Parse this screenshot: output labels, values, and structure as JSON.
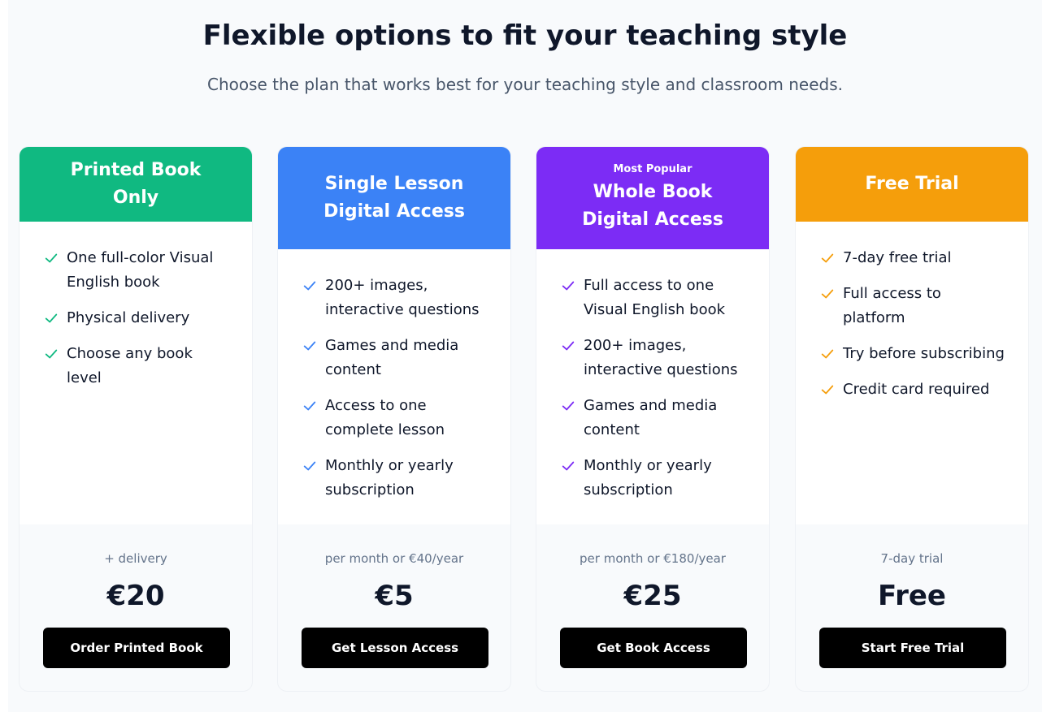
{
  "header": {
    "title": "Flexible options to fit your teaching style",
    "subtitle": "Choose the plan that works best for your teaching style and classroom needs."
  },
  "plans": [
    {
      "name": "Printed Book Only",
      "color": "#10b981",
      "features": [
        "One full-color Visual English book",
        "Physical delivery",
        "Choose any book level"
      ],
      "price_note": "+ delivery",
      "price": "€20",
      "button": "Order Printed Book"
    },
    {
      "name": "Single Lesson Digital Access",
      "color": "#3b82f6",
      "features": [
        "200+ images, interactive questions",
        "Games and media content",
        "Access to one complete lesson",
        "Monthly or yearly subscription"
      ],
      "price_note": "per month or €40/year",
      "price": "€5",
      "button": "Get Lesson Access"
    },
    {
      "name": "Whole Book Digital Access",
      "badge": "Most Popular",
      "color": "#7c2cf5",
      "features": [
        "Full access to one Visual English book",
        "200+ images, interactive questions",
        "Games and media content",
        "Monthly or yearly subscription"
      ],
      "price_note": "per month or €180/year",
      "price": "€25",
      "button": "Get Book Access"
    },
    {
      "name": "Free Trial",
      "color": "#f59e0b",
      "features": [
        "7-day free trial",
        "Full access to platform",
        "Try before subscribing",
        "Credit card required"
      ],
      "price_note": "7-day trial",
      "price": "Free",
      "button": "Start Free Trial"
    }
  ],
  "icons": {
    "feature": "check-icon"
  }
}
